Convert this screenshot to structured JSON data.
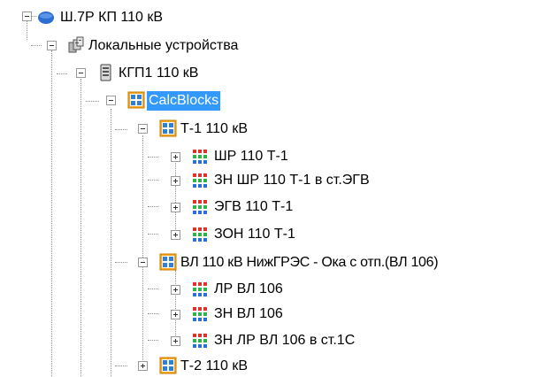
{
  "tree": {
    "root": {
      "label": "Ш.7Р КП 110 кВ",
      "icon": "globe-icon",
      "expanded": true
    },
    "local_devices": {
      "label": "Локальные устройства",
      "icon": "devices-icon",
      "expanded": true
    },
    "device": {
      "label": "КГП1 110 кВ",
      "icon": "server-icon",
      "expanded": true
    },
    "calcblocks": {
      "label": "CalcBlocks",
      "icon": "block-group-icon",
      "expanded": true,
      "selected": true
    },
    "groups": [
      {
        "label": "Т-1 110 кВ",
        "icon": "block-group-icon",
        "expanded": true,
        "items": [
          {
            "label": "ШР 110 Т-1",
            "icon": "grid-block-icon",
            "expanded": false
          },
          {
            "label": "ЗН ШР 110 Т-1 в ст.ЭГВ",
            "icon": "grid-block-icon",
            "expanded": false
          },
          {
            "label": "ЭГВ 110 Т-1",
            "icon": "grid-block-icon",
            "expanded": false
          },
          {
            "label": "ЗОН 110 Т-1",
            "icon": "grid-block-icon",
            "expanded": false
          }
        ]
      },
      {
        "label": "ВЛ 110 кВ НижГРЭС - Ока с отп.(ВЛ 106)",
        "icon": "block-group-icon",
        "expanded": true,
        "items": [
          {
            "label": "ЛР ВЛ 106",
            "icon": "grid-block-icon",
            "expanded": false
          },
          {
            "label": "ЗН ВЛ 106",
            "icon": "grid-block-icon",
            "expanded": false
          },
          {
            "label": "ЗН ЛР ВЛ 106 в ст.1С",
            "icon": "grid-block-icon",
            "expanded": false
          }
        ]
      },
      {
        "label": "Т-2 110 кВ",
        "icon": "block-group-icon",
        "expanded": false,
        "items": []
      }
    ]
  },
  "colors": {
    "selection": "#3399ff",
    "tree_lines": "#8f8f8f",
    "block_orange": "#f5a623",
    "block_blue": "#2f7fd6",
    "grid_red": "#e0312b",
    "grid_green": "#2db34a",
    "grid_blue": "#2a6fdb"
  }
}
